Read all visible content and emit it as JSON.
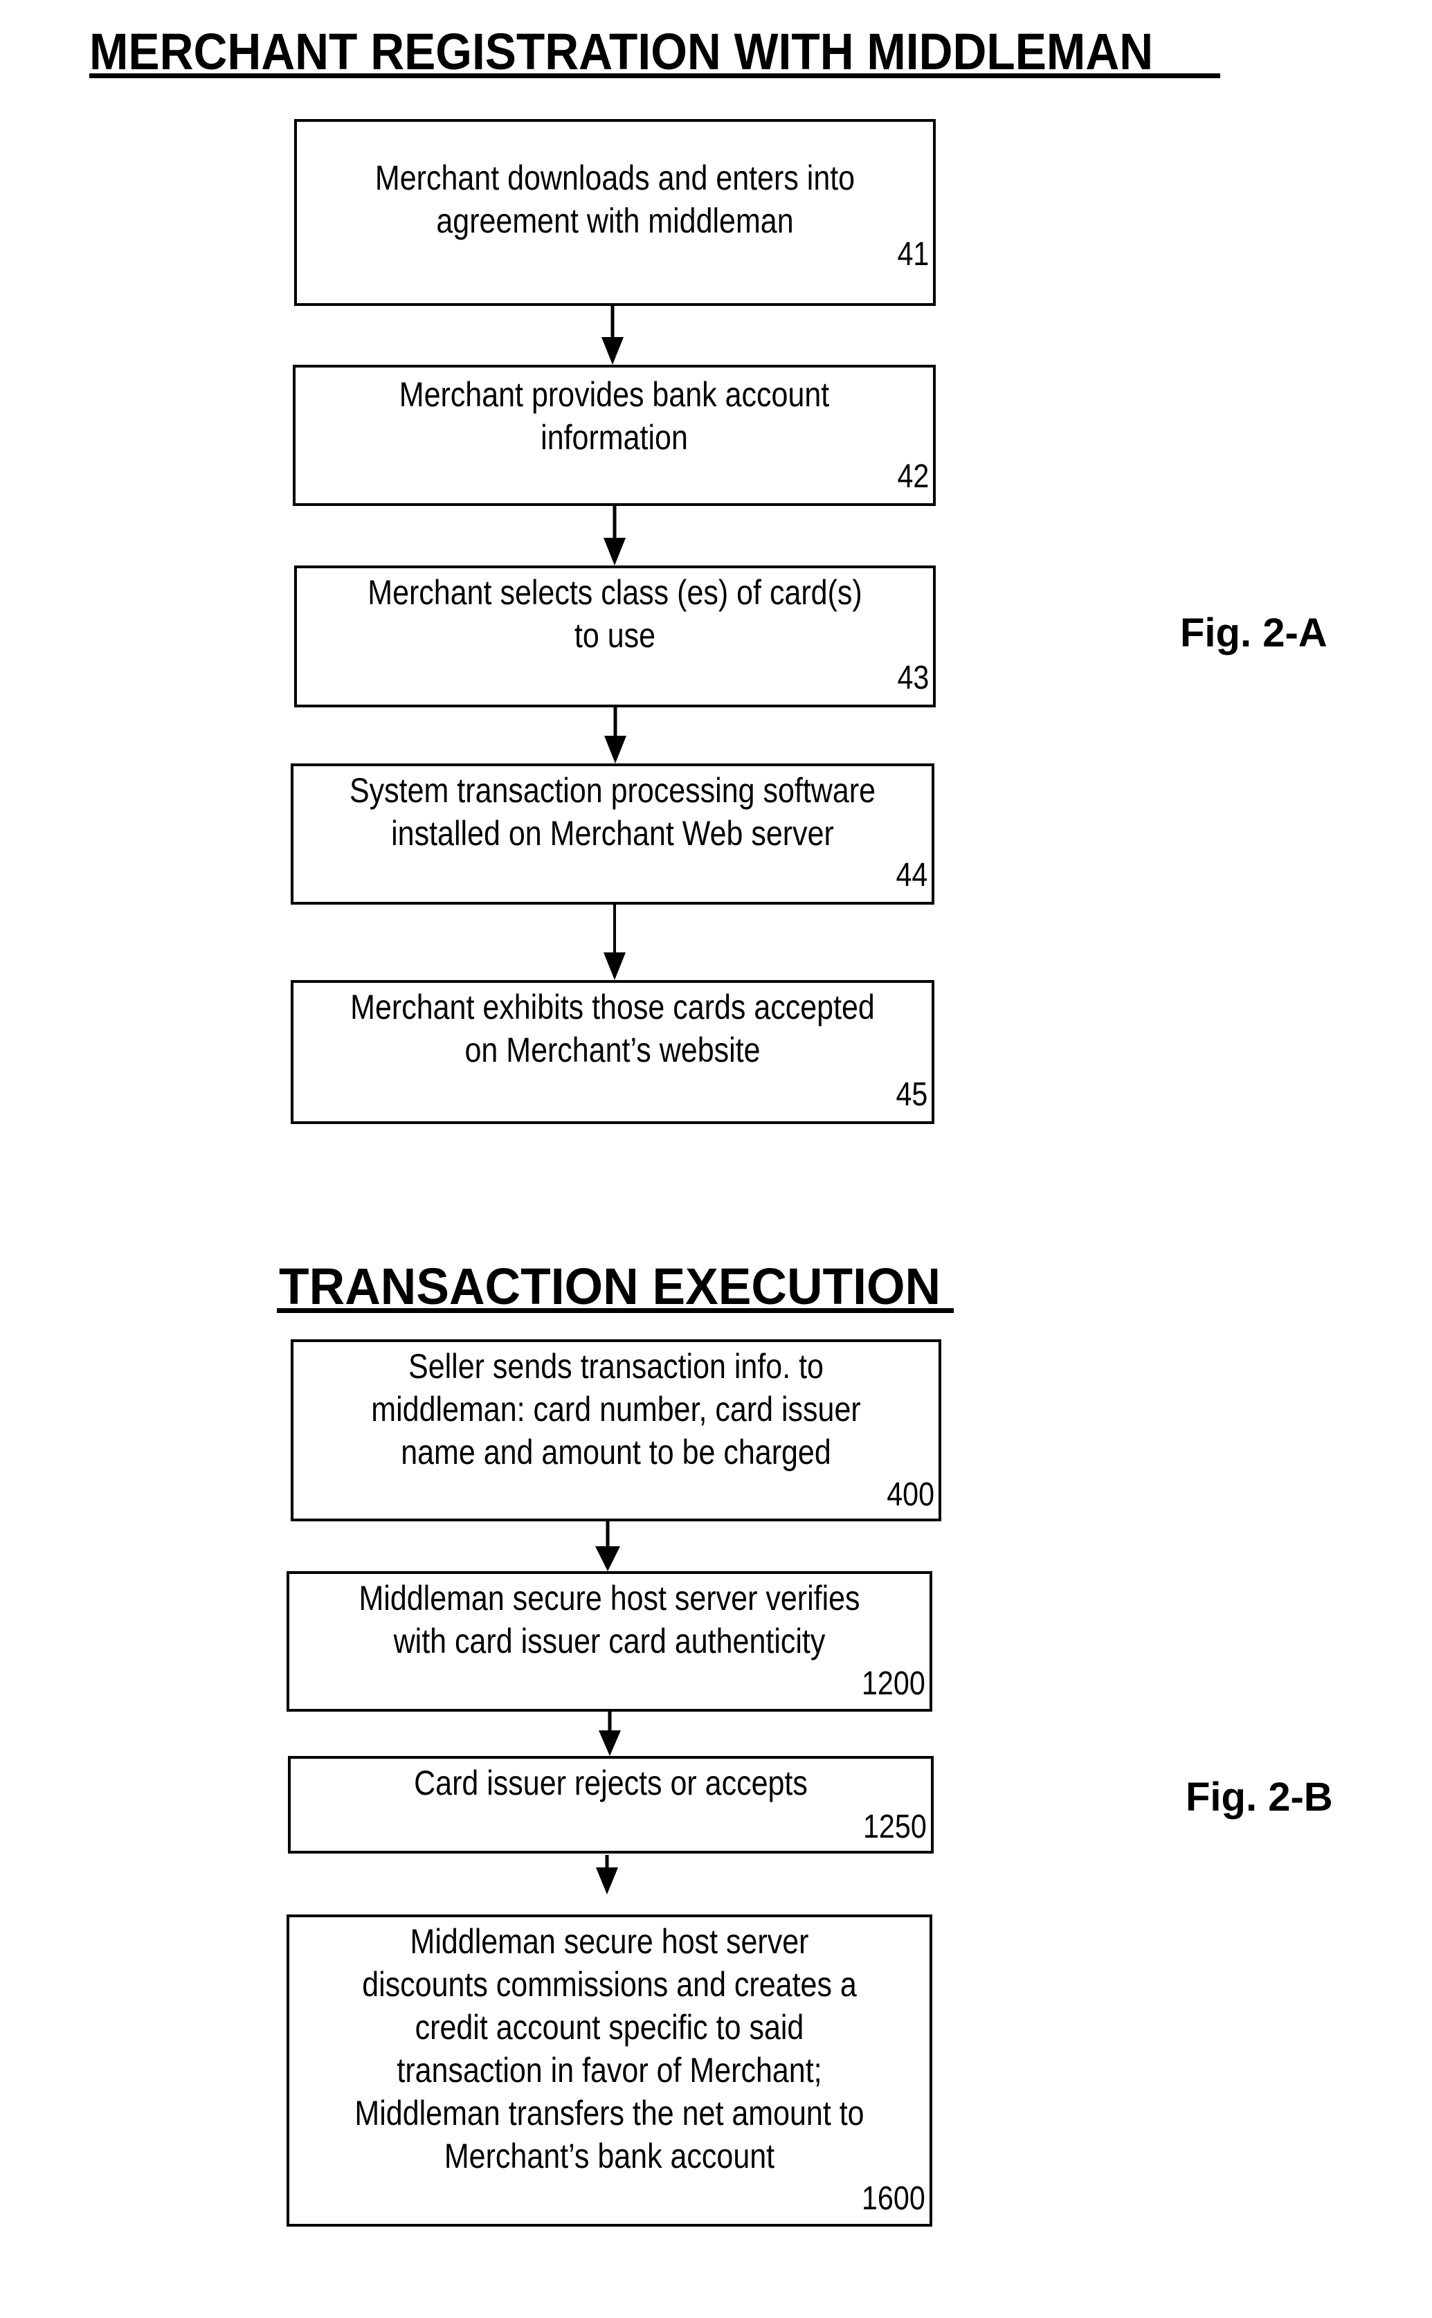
{
  "sections": [
    {
      "title": "MERCHANT REGISTRATION WITH MIDDLEMAN",
      "figure_label": "Fig. 2-A",
      "steps": [
        {
          "ref": "41",
          "lines": [
            "Merchant downloads and enters into",
            "agreement with middleman"
          ]
        },
        {
          "ref": "42",
          "lines": [
            "Merchant provides bank account",
            "information"
          ]
        },
        {
          "ref": "43",
          "lines": [
            "Merchant selects class (es) of card(s)",
            "to use"
          ]
        },
        {
          "ref": "44",
          "lines": [
            "System transaction processing software",
            "installed on Merchant Web server"
          ]
        },
        {
          "ref": "45",
          "lines": [
            "Merchant exhibits those cards accepted",
            "on Merchant’s website"
          ]
        }
      ]
    },
    {
      "title": "TRANSACTION EXECUTION",
      "figure_label": "Fig. 2-B",
      "steps": [
        {
          "ref": "400",
          "lines": [
            "Seller sends transaction info. to",
            "middleman:  card number, card issuer",
            "name and amount to be charged"
          ]
        },
        {
          "ref": "1200",
          "lines": [
            "Middleman secure host server verifies",
            "with card issuer card authenticity"
          ]
        },
        {
          "ref": "1250",
          "lines": [
            "Card issuer rejects or accepts"
          ]
        },
        {
          "ref": "1600",
          "lines": [
            "Middleman secure host server",
            "discounts commissions and creates a",
            "credit account specific to said",
            "transaction in favor of Merchant;",
            "Middleman transfers the net amount to",
            "Merchant’s bank account"
          ]
        }
      ]
    }
  ]
}
